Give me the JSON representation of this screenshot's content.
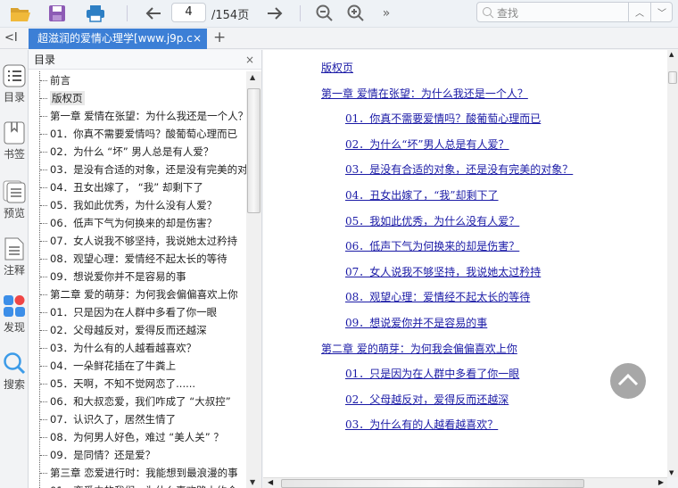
{
  "toolbar": {
    "page_current": "4",
    "page_total": "/154页",
    "search_placeholder": "查找"
  },
  "tab": {
    "title": "超滋润的爱情心理学[www.j9p.c",
    "close": "×",
    "add": "+",
    "collapse": "<I"
  },
  "sidebar": {
    "items": [
      {
        "label": "目录",
        "icon": "list-icon"
      },
      {
        "label": "书签",
        "icon": "bookmark-icon"
      },
      {
        "label": "预览",
        "icon": "preview-icon"
      },
      {
        "label": "注释",
        "icon": "note-icon"
      },
      {
        "label": "发现",
        "icon": "discover-icon"
      },
      {
        "label": "搜索",
        "icon": "search-icon"
      }
    ]
  },
  "toc": {
    "title": "目录",
    "close": "×",
    "selected": 1,
    "items": [
      "前言",
      "版权页",
      "第一章 爱情在张望：为什么我还是一个人？",
      "01．你真不需要爱情吗？酸葡萄心理而已",
      "02．为什么 “坏” 男人总是有人爱？",
      "03．是没有合适的对象，还是没有完美的对象？",
      "04．丑女出嫁了， “我” 却剩下了",
      "05．我如此优秀，为什么没有人爱？",
      "06．低声下气为何换来的却是伤害？",
      "07．女人说我不够坚持，我说她太过矜持",
      "08．观望心理：爱情经不起太长的等待",
      "09．想说爱你并不是容易的事",
      "第二章 爱的萌芽：为何我会偏偏喜欢上你",
      "01．只是因为在人群中多看了你一眼",
      "02．父母越反对，爱得反而还越深",
      "03．为什么有的人越看越喜欢？",
      "04．一朵鲜花插在了牛粪上",
      "05．天啊，不知不觉网恋了......",
      "06．和大叔恋爱，我们咋成了 “大叔控”",
      "07．认识久了，居然生情了",
      "08．为何男人好色，难过 “美人关” ？",
      "09．是同情？还是爱？",
      "第三章 恋爱进行时：我能想到最浪漫的事",
      "01．恋爱中的我们，为什么喜欢路上约会"
    ]
  },
  "document": {
    "links": [
      {
        "text": "版权页",
        "indent": 0
      },
      {
        "text": "第一章 爱情在张望：为什么我还是一个人？",
        "indent": 0
      },
      {
        "text": "01．你真不需要爱情吗？酸葡萄心理而已",
        "indent": 1
      },
      {
        "text": "02．为什么“坏”男人总是有人爱？",
        "indent": 1
      },
      {
        "text": "03．是没有合适的对象，还是没有完美的对象？",
        "indent": 1
      },
      {
        "text": "04．丑女出嫁了，“我”却剩下了",
        "indent": 1
      },
      {
        "text": "05．我如此优秀，为什么没有人爱？",
        "indent": 1
      },
      {
        "text": "06．低声下气为何换来的却是伤害？",
        "indent": 1
      },
      {
        "text": "07．女人说我不够坚持，我说她太过矜持",
        "indent": 1
      },
      {
        "text": "08．观望心理：爱情经不起太长的等待",
        "indent": 1
      },
      {
        "text": "09．想说爱你并不是容易的事",
        "indent": 1
      },
      {
        "text": "第二章 爱的萌芽：为何我会偏偏喜欢上你",
        "indent": 0
      },
      {
        "text": "01．只是因为在人群中多看了你一眼",
        "indent": 1
      },
      {
        "text": "02．父母越反对，爱得反而还越深",
        "indent": 1
      },
      {
        "text": "03．为什么有的人越看越喜欢？",
        "indent": 1
      }
    ]
  },
  "colors": {
    "accent": "#3c7fd6",
    "link": "#1a1aa6"
  }
}
